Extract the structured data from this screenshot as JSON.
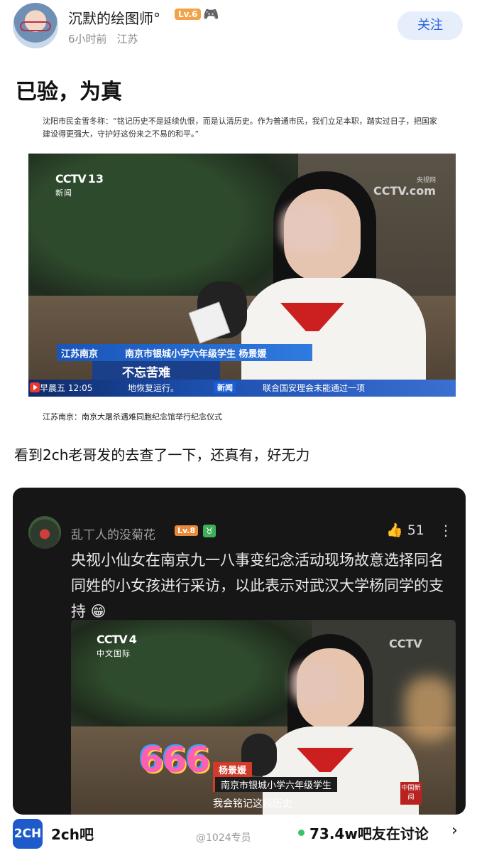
{
  "header": {
    "username": "沉默的绘图师°",
    "level_badge": "Lv.6",
    "time_ago": "6小时前",
    "location": "江苏",
    "follow_label": "关注",
    "icons": {
      "avatar": "avatar",
      "badge": "game-controller-icon"
    }
  },
  "post": {
    "title": "已验，为真",
    "quote": "沈阳市民金雪冬称：“铭记历史不是延续仇恨，而是认清历史。作为普通市民，我们立足本职，踏实过日子，把国家建设得更强大，守护好这份来之不易的和平。”",
    "video1": {
      "channel_logo": "CCTV",
      "channel_num": "13",
      "channel_sub": "新闻",
      "corner_logo": "CCTV",
      "corner_sub": "央视网",
      "corner_domain": "com",
      "location_tag": "江苏南京",
      "person_tag": "南京市银城小学六年级学生 杨景媛",
      "headline": "不忘苦难",
      "time": "早晨五 12:05",
      "ticker": "地恢复运行。",
      "ticker_live": "新闻",
      "ticker2": "联合国安理会未能通过一项"
    },
    "caption": "江苏南京：南京大屠杀遇难同胞纪念馆举行纪念仪式",
    "body_text": "看到2ch老哥发的去查了一下，还真有，好无力"
  },
  "quoted_card": {
    "username": "乱丅人的没菊花",
    "level_badge": "Lv.8",
    "like_count": "51",
    "text": "央视小仙女在南京九一八事变纪念活动现场故意选择同名同姓的小女孩进行采访，以此表示对武汉大学杨同学的支持 😁",
    "video2": {
      "channel_logo": "CCTV",
      "channel_num": "4",
      "channel_sub": "中文国际",
      "corner_logo": "CCTV",
      "overlay_number": "666",
      "name_tag": "杨景媛",
      "school_tag": "南京市银城小学六年级学生",
      "subtitle": "我会铭记这段历史",
      "corner_badge": "中国新闻"
    }
  },
  "footer": {
    "app_icon": "2CH",
    "app_name": "2ch吧",
    "watermark": "@1024专员",
    "discussion": "73.4w吧友在讨论",
    "arrow": "›"
  },
  "colors": {
    "follow_bg": "#e6eefc",
    "follow_text": "#2b63d6",
    "card_bg": "#161616",
    "online_dot": "#36c46a",
    "app_icon_bg": "#1e5ac9"
  }
}
